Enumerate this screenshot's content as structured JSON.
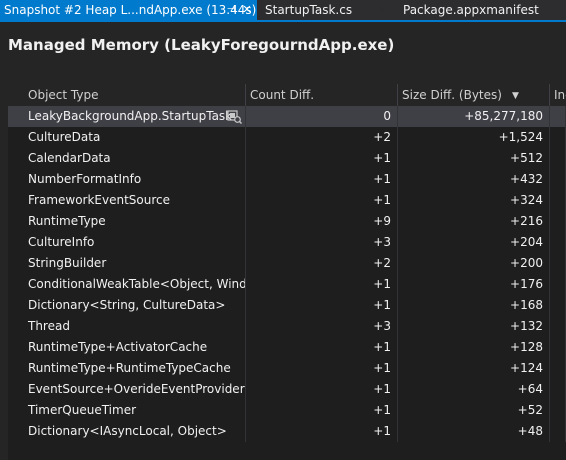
{
  "tabs": [
    {
      "label": "Snapshot #2 Heap L...ndApp.exe (13.44s)",
      "active": true,
      "pin_glyph": "⊣",
      "close_glyph": "✕"
    },
    {
      "label": "StartupTask.cs",
      "active": false,
      "close_glyph": "✕"
    },
    {
      "label": "Package.appxmanifest",
      "active": false
    }
  ],
  "page_title": "Managed Memory (LeakyForegourndApp.exe)",
  "table": {
    "columns": [
      "Object Type",
      "Count Diff.",
      "Size Diff. (Bytes)",
      "Inc"
    ],
    "sort_icon": "▼",
    "rows": [
      {
        "name": "LeakyBackgroundApp.StartupTask",
        "count": "0",
        "size": "+85,277,180",
        "selected": true
      },
      {
        "name": "CultureData",
        "count": "+2",
        "size": "+1,524"
      },
      {
        "name": "CalendarData",
        "count": "+1",
        "size": "+512"
      },
      {
        "name": "NumberFormatInfo",
        "count": "+1",
        "size": "+432"
      },
      {
        "name": "FrameworkEventSource",
        "count": "+1",
        "size": "+324"
      },
      {
        "name": "RuntimeType",
        "count": "+9",
        "size": "+216"
      },
      {
        "name": "CultureInfo",
        "count": "+3",
        "size": "+204"
      },
      {
        "name": "StringBuilder",
        "count": "+2",
        "size": "+200"
      },
      {
        "name": "ConditionalWeakTable<Object, Wind...",
        "count": "+1",
        "size": "+176"
      },
      {
        "name": "Dictionary<String, CultureData>",
        "count": "+1",
        "size": "+168"
      },
      {
        "name": "Thread",
        "count": "+3",
        "size": "+132"
      },
      {
        "name": "RuntimeType+ActivatorCache",
        "count": "+1",
        "size": "+128"
      },
      {
        "name": "RuntimeType+RuntimeTypeCache",
        "count": "+1",
        "size": "+124"
      },
      {
        "name": "EventSource+OverideEventProvider",
        "count": "+1",
        "size": "+64"
      },
      {
        "name": "TimerQueueTimer",
        "count": "+1",
        "size": "+52"
      },
      {
        "name": "Dictionary<IAsyncLocal, Object>",
        "count": "+1",
        "size": "+48"
      }
    ]
  },
  "colors": {
    "accent": "#007acc",
    "background": "#252526",
    "grid": "#1e1e1e",
    "selected_row": "#3f3f46"
  }
}
